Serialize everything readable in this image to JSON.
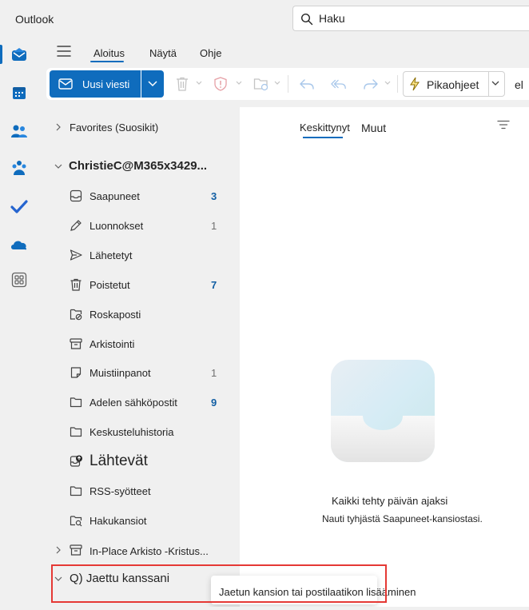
{
  "app": {
    "title": "Outlook"
  },
  "search": {
    "placeholder": "Haku",
    "value": "Haku"
  },
  "ribbon": {
    "tabs": [
      {
        "label": "Aloitus",
        "active": true
      },
      {
        "label": "Näytä",
        "active": false
      },
      {
        "label": "Ohje",
        "active": false
      }
    ],
    "new_mail_label": "Uusi viesti",
    "quick_steps_label": "Pikaohjeet",
    "overflow_label": "el"
  },
  "rail": {
    "items": [
      "mail-icon",
      "calendar-icon",
      "people-icon",
      "groups-icon",
      "todo-icon",
      "onedrive-icon",
      "apps-icon"
    ]
  },
  "folders": {
    "favorites_label": "Favorites (Suosikit)",
    "account_label": "ChristieC@M365x3429...",
    "items": [
      {
        "label": "Saapuneet",
        "icon": "inbox-icon",
        "count": "3",
        "count_style": "bold"
      },
      {
        "label": "Luonnokset",
        "icon": "drafts-icon",
        "count": "1",
        "count_style": "muted"
      },
      {
        "label": "Lähetetyt",
        "icon": "sent-icon",
        "count": "",
        "count_style": ""
      },
      {
        "label": "Poistetut",
        "icon": "trash-icon",
        "count": "7",
        "count_style": "bold"
      },
      {
        "label": "Roskaposti",
        "icon": "junk-icon",
        "count": "",
        "count_style": ""
      },
      {
        "label": "Arkistointi",
        "icon": "archive-icon",
        "count": "",
        "count_style": ""
      },
      {
        "label": "Muistiinpanot",
        "icon": "notes-icon",
        "count": "1",
        "count_style": "muted"
      },
      {
        "label": "Adelen sähköpostit",
        "icon": "folder-icon",
        "count": "9",
        "count_style": "bold"
      },
      {
        "label": "Keskusteluhistoria",
        "icon": "folder-icon",
        "count": "",
        "count_style": ""
      },
      {
        "label": "Lähtevät",
        "icon": "outbox-icon",
        "count": "",
        "count_style": ""
      },
      {
        "label": "RSS-syötteet",
        "icon": "folder-icon",
        "count": "",
        "count_style": ""
      },
      {
        "label": "Hakukansiot",
        "icon": "search-folder-icon",
        "count": "",
        "count_style": ""
      }
    ],
    "archive_label": "In-Place Arkisto -Kristus...",
    "shared_label": "Q) Jaettu kanssani"
  },
  "message_list": {
    "tabs": [
      {
        "label": "Keskittynyt",
        "active": true
      },
      {
        "label": "Muut",
        "active": false
      }
    ],
    "empty_title": "Kaikki tehty päivän ajaksi",
    "empty_subtitle": "Nauti tyhjästä Saapuneet-kansiostasi."
  },
  "tooltip": {
    "text": "Jaetun kansion tai postilaatikon lisääminen"
  },
  "colors": {
    "accent": "#0f6cbd",
    "highlight": "#e53935",
    "pane_bg": "#f0f0f0"
  }
}
